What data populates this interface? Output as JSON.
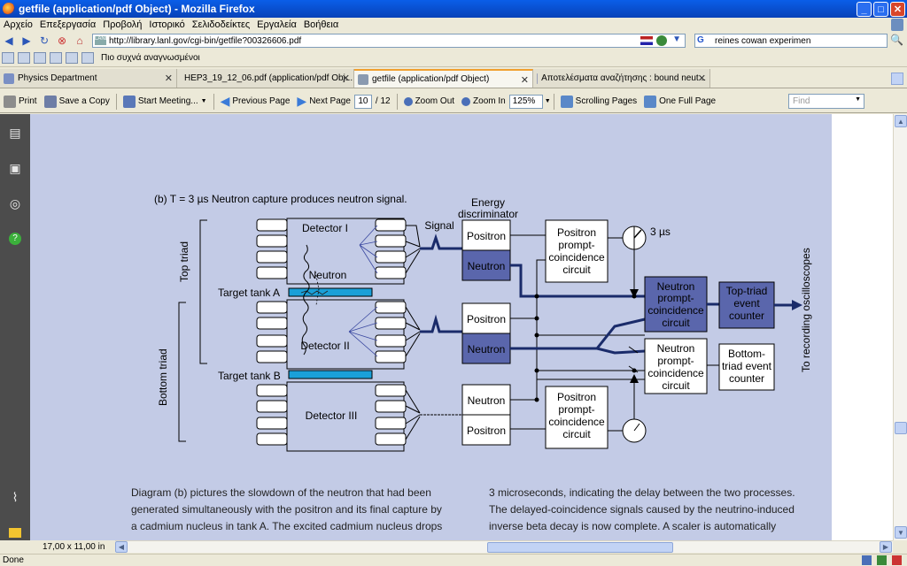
{
  "window": {
    "title": "getfile (application/pdf Object) - Mozilla Firefox"
  },
  "menu": [
    "Αρχείο",
    "Επεξεργασία",
    "Προβολή",
    "Ιστορικό",
    "Σελιδοδείκτες",
    "Εργαλεία",
    "Βοήθεια"
  ],
  "nav": {
    "url": "http://library.lanl.gov/cgi-bin/getfile?00326606.pdf",
    "site_label": "LANL",
    "search_value": "reines cowan experimen"
  },
  "bookmarks": {
    "most_visited": "Πιο συχνά αναγνωσμένοι"
  },
  "tabs": [
    {
      "label": "Physics Department",
      "active": false
    },
    {
      "label": "HEP3_19_12_06.pdf (application/pdf Obj...",
      "active": false
    },
    {
      "label": "getfile (application/pdf Object)",
      "active": true
    },
    {
      "label": "Αποτελέσματα αναζήτησης : bound neut...",
      "active": false
    }
  ],
  "pdf_toolbar": {
    "print": "Print",
    "save_copy": "Save a Copy",
    "start_meeting": "Start Meeting...",
    "prev_page": "Previous Page",
    "next_page": "Next Page",
    "page_current": "10",
    "page_total": "/ 12",
    "zoom_out": "Zoom Out",
    "zoom_in": "Zoom In",
    "zoom_value": "125%",
    "scrolling_pages": "Scrolling Pages",
    "one_full_page": "One Full Page",
    "find_placeholder": "Find"
  },
  "diagram": {
    "caption": "(b)  T = 3 µs   Neutron capture produces neutron signal.",
    "energy_discriminator": [
      "Energy",
      "discriminator"
    ],
    "signal": "Signal",
    "top_triad": "Top triad",
    "bottom_triad": "Bottom triad",
    "detector_1": "Detector I",
    "detector_2": "Detector II",
    "detector_3": "Detector III",
    "neutron": "Neutron",
    "target_a": "Target tank A",
    "target_b": "Target tank B",
    "positron": "Positron",
    "neutron_label": "Neutron",
    "positron_prompt": [
      "Positron",
      "prompt-",
      "coincidence",
      "circuit"
    ],
    "neutron_prompt": [
      "Neutron",
      "prompt-",
      "coincidence",
      "circuit"
    ],
    "top_counter": [
      "Top-triad",
      "event",
      "counter"
    ],
    "bottom_counter": [
      "Bottom-",
      "triad event",
      "counter"
    ],
    "delay": "3 µs",
    "oscilloscopes": "To recording oscilloscopes"
  },
  "body_text": {
    "left": [
      "Diagram (b) pictures the slowdown of the neutron that had been",
      "generated simultaneously with the positron and its final capture by",
      "a cadmium nucleus in tank A. The excited cadmium nucleus drops"
    ],
    "right": [
      "3 microseconds, indicating the delay between the two processes.",
      "The delayed-coincidence signals caused by the neutrino-induced",
      "inverse beta decay is now complete. A scaler is automatically"
    ]
  },
  "page_size": "17,00 x 11,00 in",
  "status": "Done",
  "colors": {
    "page_bg": "#c3cbe6",
    "neutron_box": "#5a66ac",
    "tank": "#1aa0d8",
    "title_bar": "#0a5ee8"
  }
}
